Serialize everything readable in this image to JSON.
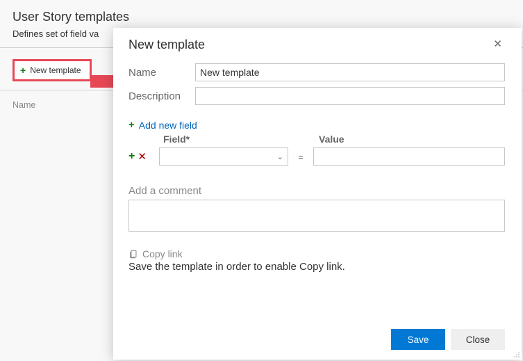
{
  "page": {
    "title": "User Story templates",
    "description": "Defines set of field va",
    "new_template_button": "New template",
    "column_header": "Name"
  },
  "dialog": {
    "title": "New template",
    "labels": {
      "name": "Name",
      "description": "Description",
      "add_new_field": "Add new field",
      "field_header": "Field*",
      "value_header": "Value",
      "equals": "=",
      "comment_section": "Add a comment",
      "copy_link": "Copy link",
      "copy_link_hint": "Save the template in order to enable Copy link."
    },
    "values": {
      "name": "New template",
      "description": "",
      "field": "",
      "value": "",
      "comment": ""
    },
    "buttons": {
      "save": "Save",
      "close": "Close"
    }
  }
}
